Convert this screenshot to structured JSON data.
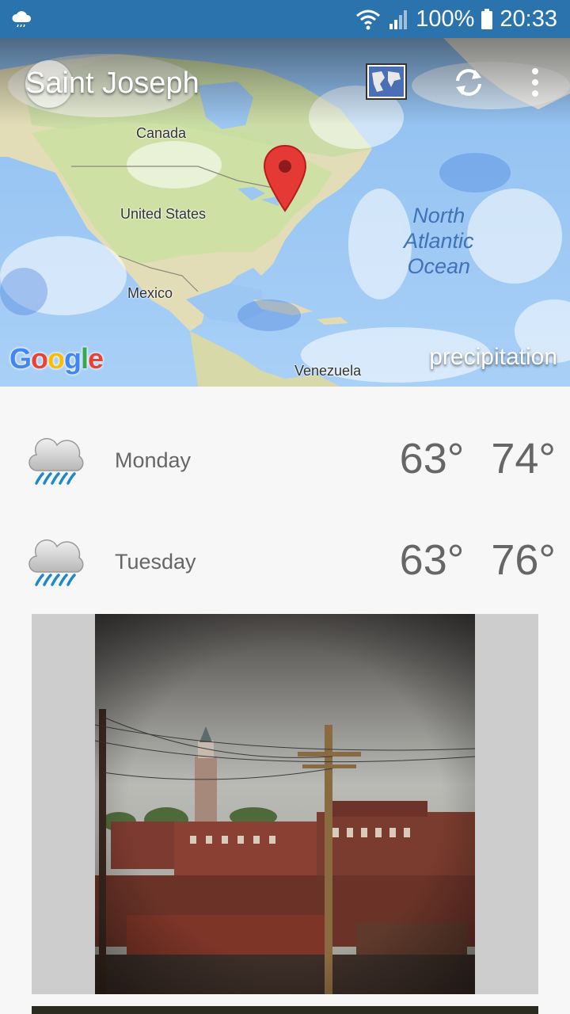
{
  "status_bar": {
    "battery": "100%",
    "time": "20:33",
    "icons": [
      "weather-cloud-icon",
      "wifi-icon",
      "signal-icon",
      "battery-icon"
    ]
  },
  "map": {
    "location_title": "Saint Joseph",
    "labels": {
      "canada": "Canada",
      "united_states": "United States",
      "mexico": "Mexico",
      "venezuela": "Venezuela",
      "ocean_line1": "North",
      "ocean_line2": "Atlantic",
      "ocean_line3": "Ocean"
    },
    "google_logo": "Google",
    "layer_name": "precipitation",
    "icons": [
      "compass-icon",
      "map-layers-icon",
      "refresh-icon",
      "more-vert-icon",
      "location-pin-icon"
    ]
  },
  "forecast": [
    {
      "day": "Monday",
      "low": "63°",
      "high": "74°",
      "icon": "rain-cloud-icon"
    },
    {
      "day": "Tuesday",
      "low": "63°",
      "high": "76°",
      "icon": "rain-cloud-icon"
    }
  ],
  "colors": {
    "status_bar": "#2a73ad",
    "background": "#f7f7f7",
    "text": "#666666",
    "rain_blue": "#1e88c8",
    "pin_red": "#e53935"
  }
}
